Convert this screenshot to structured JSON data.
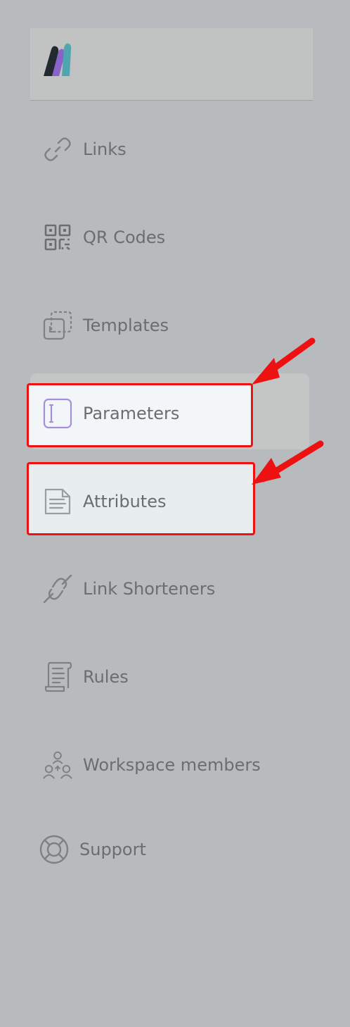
{
  "sidebar": {
    "logo": {
      "name": "app-logo",
      "colors": [
        "#222222",
        "#8a63c8",
        "#4fa5b0"
      ]
    },
    "items": [
      {
        "label": "Links",
        "icon": "link-icon"
      },
      {
        "label": "QR Codes",
        "icon": "qr-code-icon"
      },
      {
        "label": "Templates",
        "icon": "templates-icon"
      },
      {
        "label": "Parameters",
        "icon": "parameters-icon",
        "active": true
      },
      {
        "label": "Attributes",
        "icon": "document-icon"
      },
      {
        "label": "Link Shorteners",
        "icon": "broken-link-icon"
      },
      {
        "label": "Rules",
        "icon": "scroll-icon"
      },
      {
        "label": "Workspace members",
        "icon": "members-icon"
      },
      {
        "label": "Support",
        "icon": "lifebuoy-icon"
      }
    ]
  },
  "annotations": {
    "highlight_color": "#ee1111",
    "highlighted_items": [
      "Parameters",
      "Attributes"
    ]
  }
}
